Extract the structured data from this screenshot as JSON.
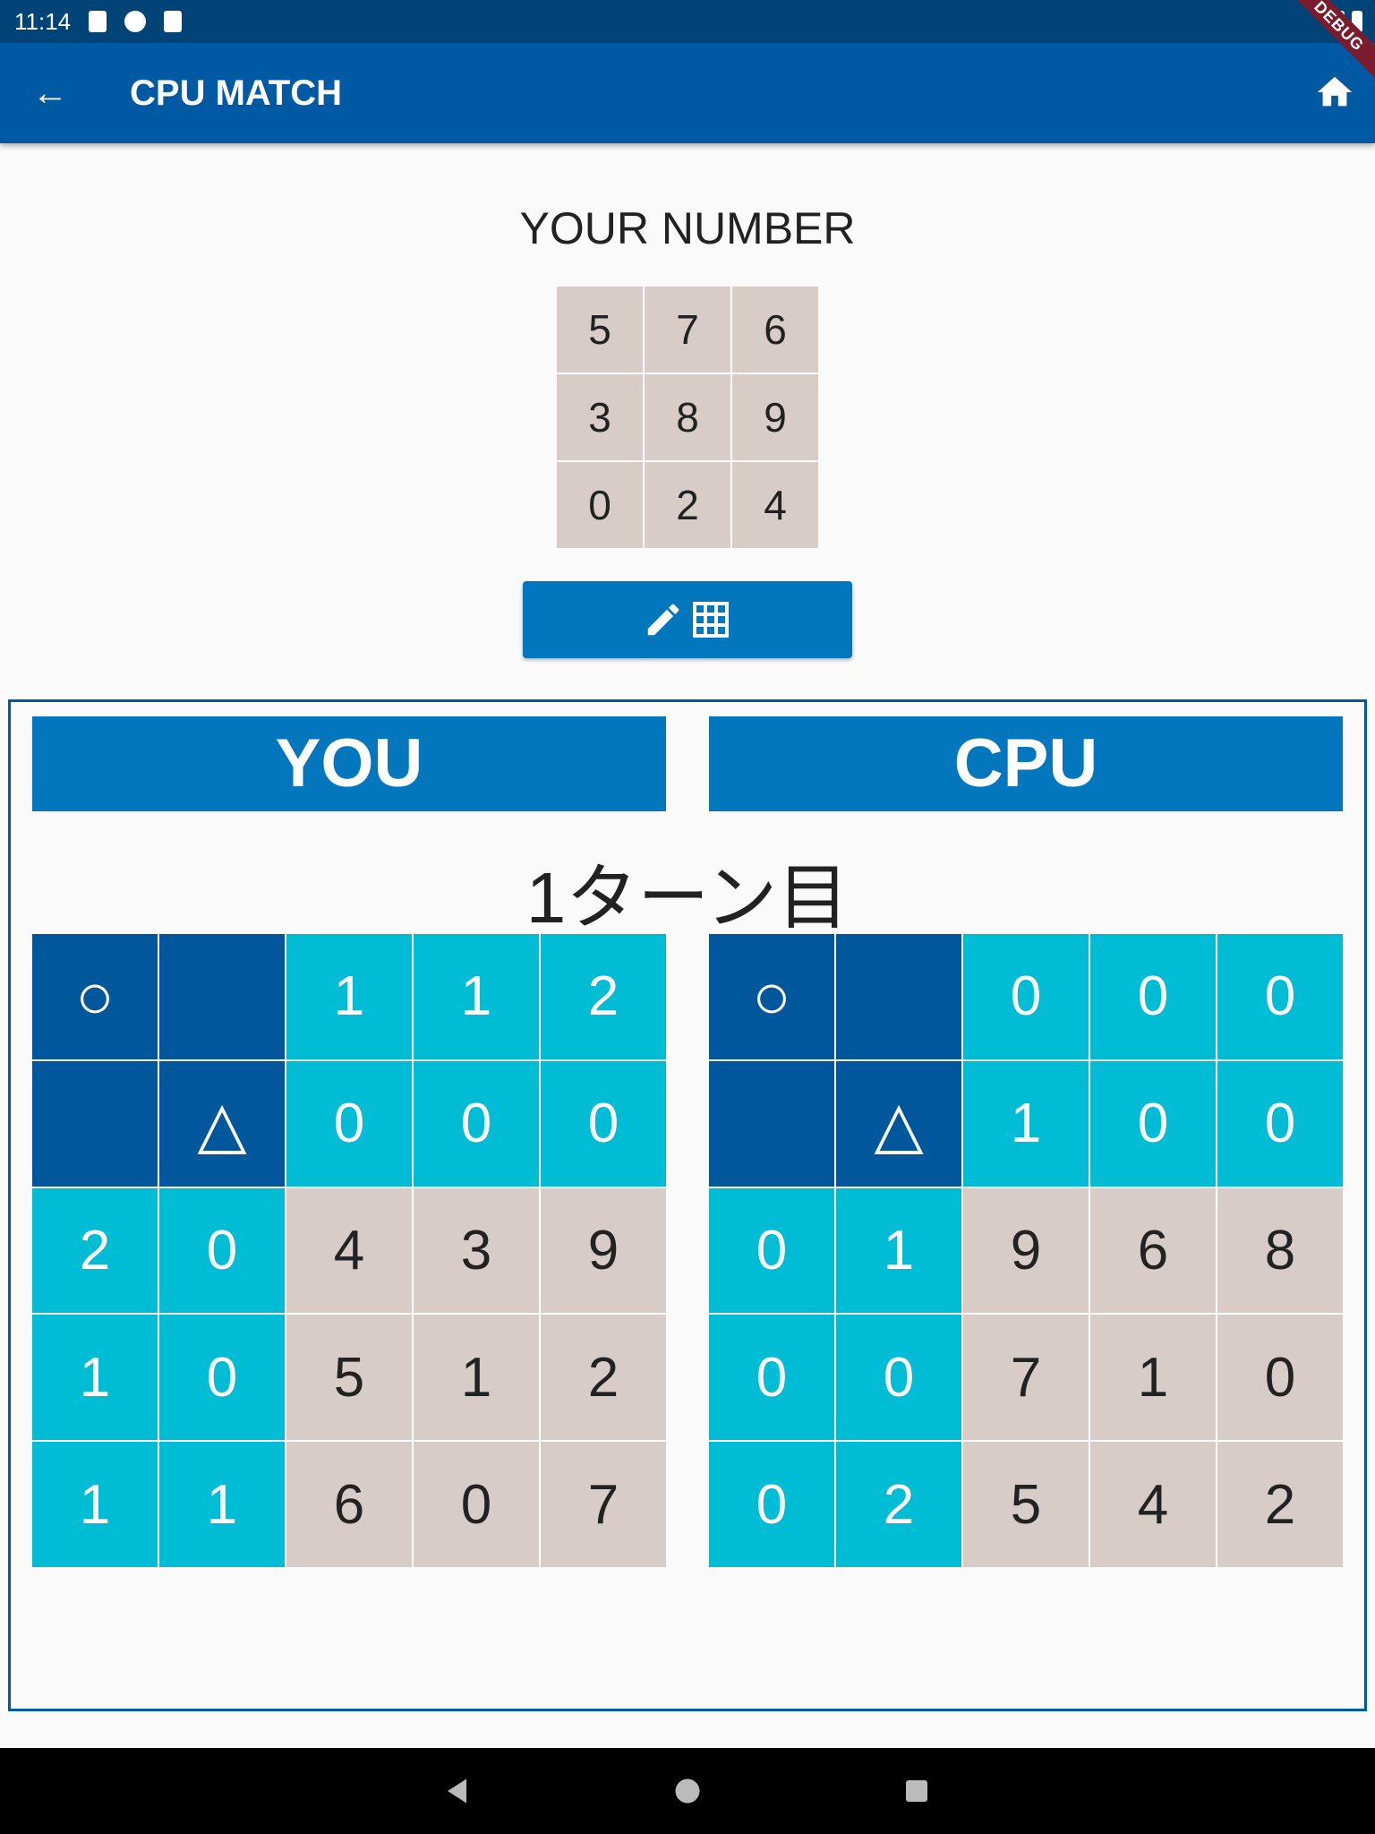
{
  "status": {
    "time": "11:14"
  },
  "appbar": {
    "title": "CPU MATCH",
    "back_icon": "arrow-back-icon",
    "home_icon": "home-icon",
    "debug": "DEBUG"
  },
  "your_number": {
    "label": "YOUR NUMBER",
    "grid": [
      "5",
      "7",
      "6",
      "3",
      "8",
      "9",
      "0",
      "2",
      "4"
    ]
  },
  "edit_button": {
    "icons": [
      "pencil-icon",
      "grid-icon"
    ]
  },
  "players": {
    "you": "YOU",
    "cpu": "CPU"
  },
  "turn": "1ターン目",
  "you_grid": [
    [
      "○",
      "",
      "1",
      "1",
      "2"
    ],
    [
      "",
      "△",
      "0",
      "0",
      "0"
    ],
    [
      "2",
      "0",
      "4",
      "3",
      "9"
    ],
    [
      "1",
      "0",
      "5",
      "1",
      "2"
    ],
    [
      "1",
      "1",
      "6",
      "0",
      "7"
    ]
  ],
  "cpu_grid": [
    [
      "○",
      "",
      "0",
      "0",
      "0"
    ],
    [
      "",
      "△",
      "1",
      "0",
      "0"
    ],
    [
      "0",
      "1",
      "9",
      "6",
      "8"
    ],
    [
      "0",
      "0",
      "7",
      "1",
      "0"
    ],
    [
      "0",
      "2",
      "5",
      "4",
      "2"
    ]
  ],
  "colors": {
    "appbar": "#0059a3",
    "header": "#0277bd",
    "dark_cell": "#01579b",
    "hint_cell": "#00bcd4",
    "number_cell": "#d7ccc8"
  }
}
